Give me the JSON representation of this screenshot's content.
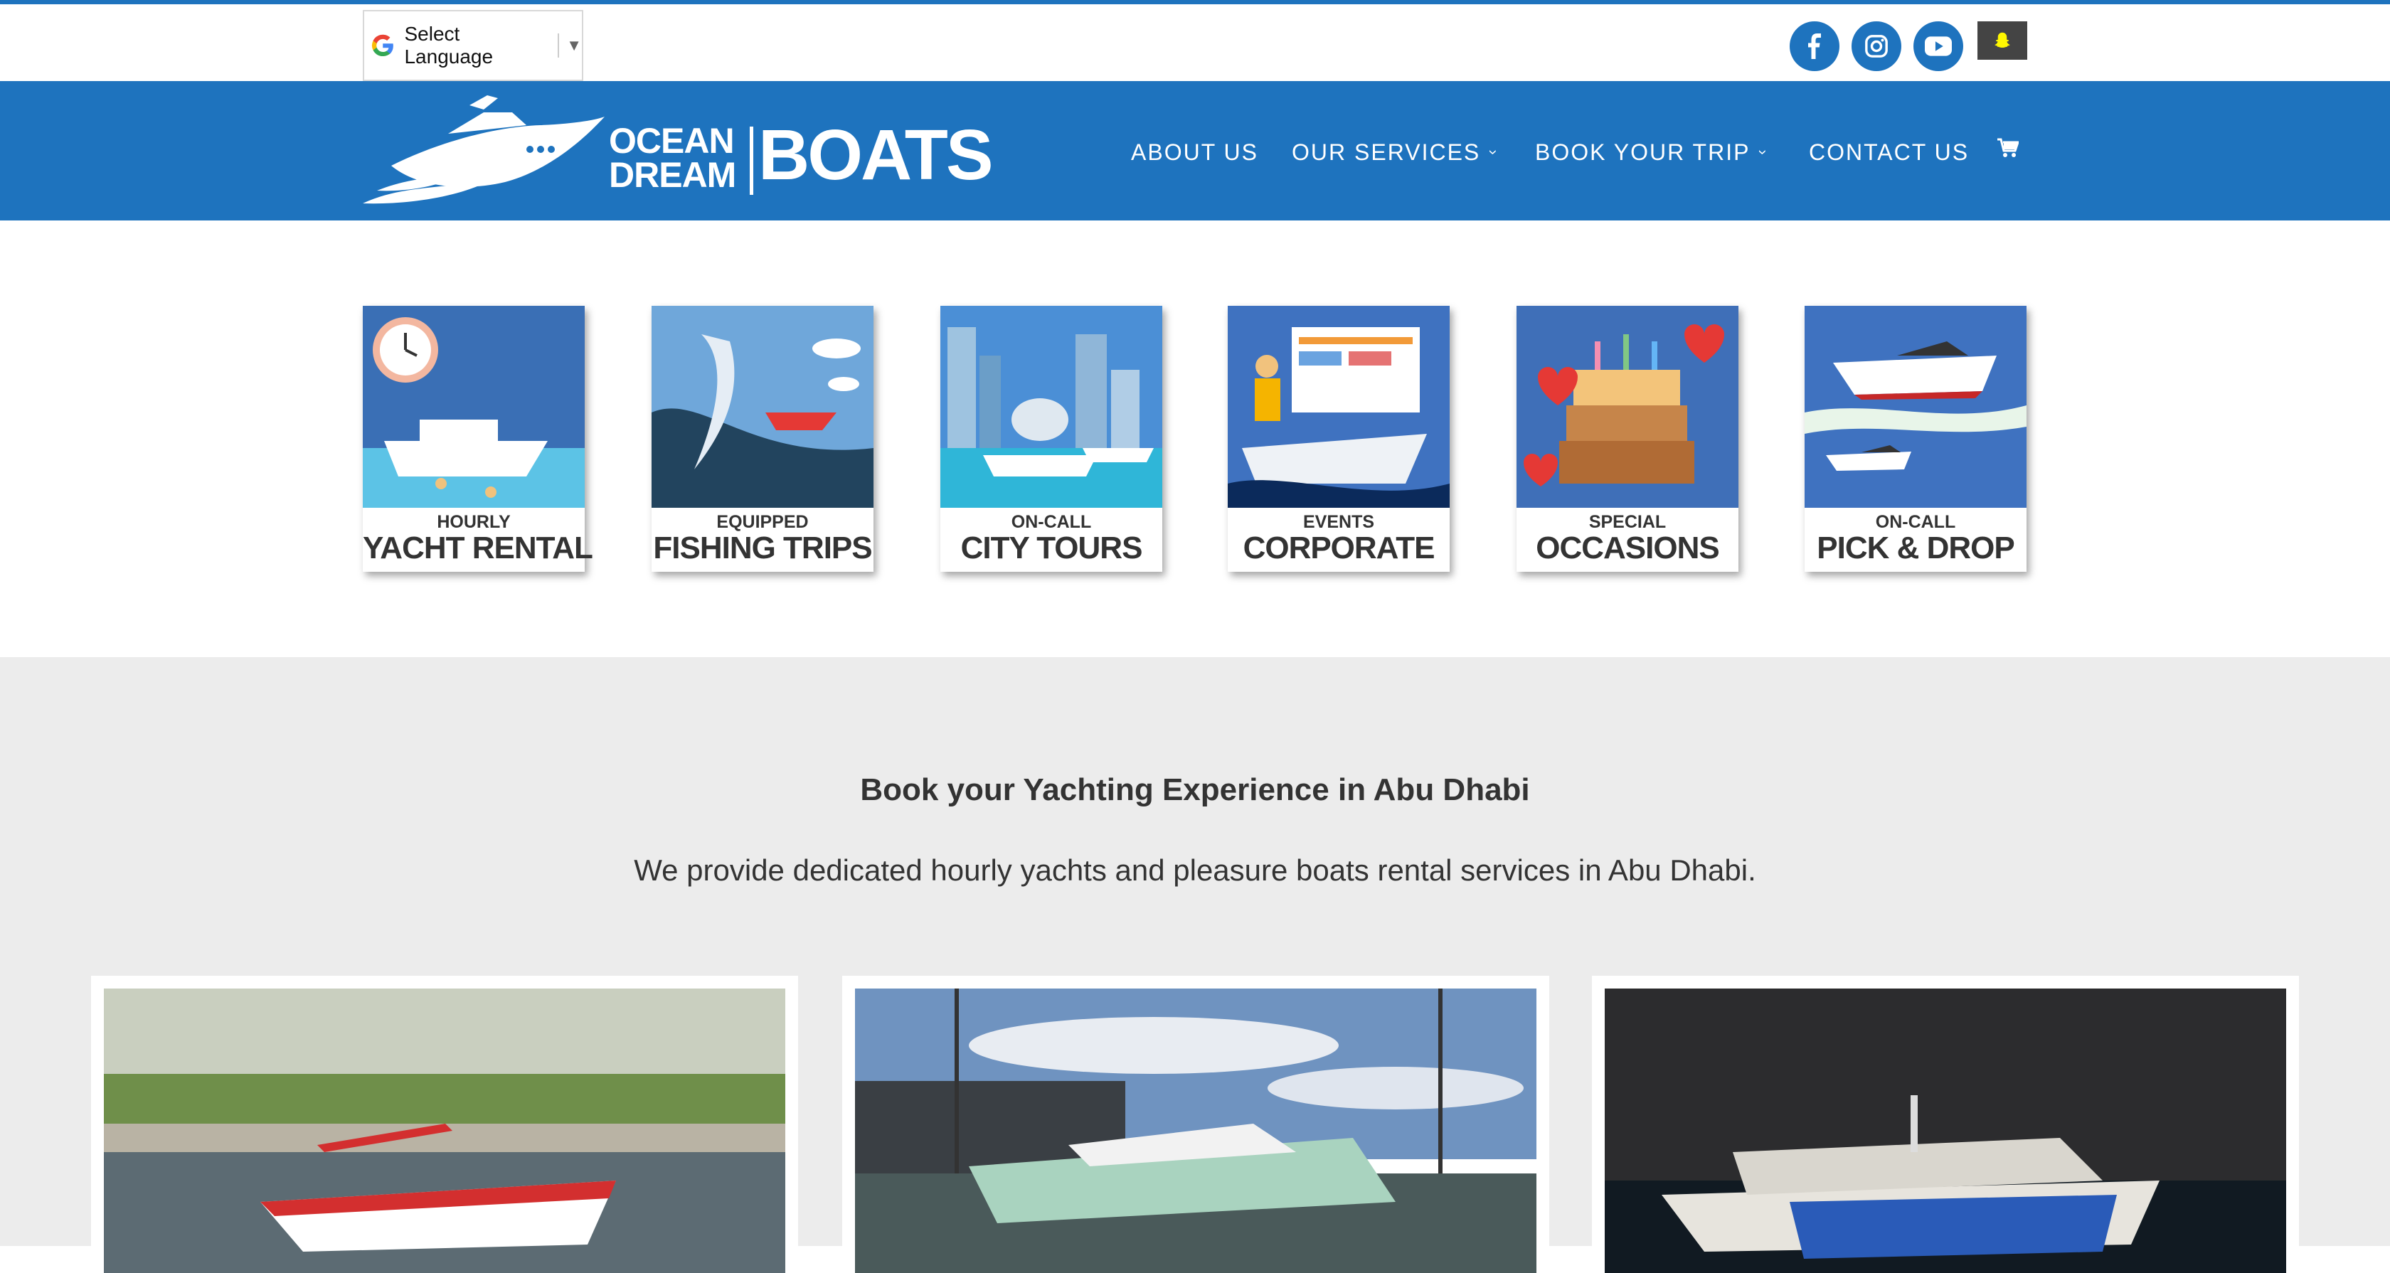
{
  "topbar": {
    "language_label": "Select Language",
    "language_arrow": "▼",
    "social": [
      "facebook-icon",
      "instagram-icon",
      "youtube-icon",
      "snapchat-icon"
    ]
  },
  "header": {
    "logo": {
      "line1": "OCEAN",
      "line2": "DREAM",
      "word": "BOATS"
    },
    "nav": [
      {
        "label": "ABOUT US",
        "has_dropdown": false
      },
      {
        "label": "OUR SERVICES",
        "has_dropdown": true
      },
      {
        "label": "BOOK YOUR TRIP",
        "has_dropdown": true
      },
      {
        "label": "CONTACT US",
        "has_dropdown": false
      }
    ],
    "cart_icon": "shopping-cart-icon",
    "chevron": "›"
  },
  "services": [
    {
      "small": "HOURLY",
      "big": "YACHT RENTAL"
    },
    {
      "small": "EQUIPPED",
      "big": "FISHING TRIPS"
    },
    {
      "small": "ON-CALL",
      "big": "CITY TOURS"
    },
    {
      "small": "EVENTS",
      "big": "CORPORATE"
    },
    {
      "small": "SPECIAL",
      "big": "OCCASIONS"
    },
    {
      "small": "ON-CALL",
      "big": "PICK & DROP"
    }
  ],
  "booking": {
    "title": "Book your Yachting Experience in Abu Dhabi",
    "subtitle": "We provide dedicated hourly yachts and pleasure boats rental services in Abu Dhabi."
  },
  "colors": {
    "brand": "#1e73be",
    "section_bg": "#ececec",
    "text": "#333333"
  }
}
